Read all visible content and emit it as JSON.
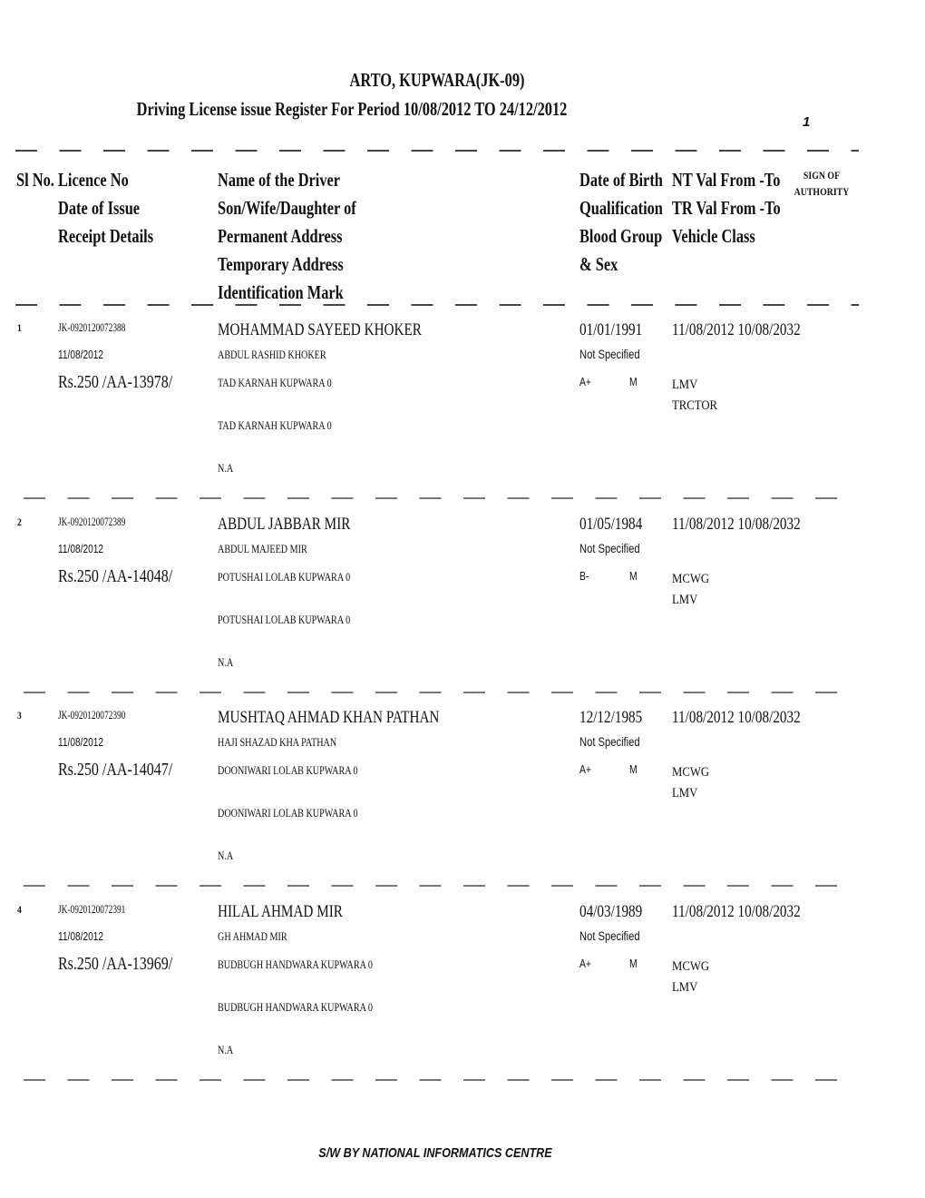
{
  "header": {
    "office": "ARTO, KUPWARA(JK-09)",
    "report_title": "Driving License issue Register For Period 10/08/2012 TO 24/12/2012",
    "page_number": "1"
  },
  "columns": {
    "col1": [
      "Sl No."
    ],
    "col2": [
      "Licence No",
      "Date of Issue",
      "Receipt  Details"
    ],
    "col3": [
      "Name of the Driver",
      "Son/Wife/Daughter of",
      "Permanent Address",
      "Temporary Address",
      "Identification Mark"
    ],
    "col4": [
      "Date of Birth",
      "Qualification",
      "Blood Group",
      "& Sex"
    ],
    "col5": [
      "NT Val From -To",
      "TR Val From -To",
      "Vehicle Class"
    ],
    "col6": [
      "SIGN OF",
      "AUTHORITY"
    ]
  },
  "records": [
    {
      "sl_no": "1",
      "licence_no": "JK-0920120072388",
      "date_of_issue": "11/08/2012",
      "receipt": "Rs.250 /AA-13978/",
      "driver_name": "MOHAMMAD SAYEED KHOKER",
      "relation_name": "ABDUL RASHID KHOKER",
      "permanent_address": "TAD  KARNAH  KUPWARA   0",
      "temporary_address": "TAD  KARNAH  KUPWARA   0",
      "identification_mark": "N.A",
      "dob": "01/01/1991",
      "qualification": "Not Specified",
      "blood_group": "A+",
      "sex": "M",
      "nt_validity": "11/08/2012  10/08/2032",
      "vehicle_classes": [
        "LMV",
        "TRCTOR"
      ]
    },
    {
      "sl_no": "2",
      "licence_no": "JK-0920120072389",
      "date_of_issue": "11/08/2012",
      "receipt": "Rs.250 /AA-14048/",
      "driver_name": "ABDUL JABBAR MIR",
      "relation_name": "ABDUL  MAJEED MIR",
      "permanent_address": "POTUSHAI  LOLAB KUPWARA  0",
      "temporary_address": "POTUSHAI  LOLAB KUPWARA  0",
      "identification_mark": "N.A",
      "dob": "01/05/1984",
      "qualification": "Not Specified",
      "blood_group": "B-",
      "sex": "M",
      "nt_validity": "11/08/2012  10/08/2032",
      "vehicle_classes": [
        "MCWG",
        "LMV"
      ]
    },
    {
      "sl_no": "3",
      "licence_no": "JK-0920120072390",
      "date_of_issue": "11/08/2012",
      "receipt": "Rs.250 /AA-14047/",
      "driver_name": "MUSHTAQ AHMAD KHAN PATHAN",
      "relation_name": "HAJI  SHAZAD  KHA  PATHAN",
      "permanent_address": "DOONIWARI LOLAB    KUPWARA  0",
      "temporary_address": "DOONIWARI LOLAB    KUPWARA  0",
      "identification_mark": "N.A",
      "dob": "12/12/1985",
      "qualification": "Not Specified",
      "blood_group": "A+",
      "sex": "M",
      "nt_validity": "11/08/2012  10/08/2032",
      "vehicle_classes": [
        "MCWG",
        "LMV"
      ]
    },
    {
      "sl_no": "4",
      "licence_no": "JK-0920120072391",
      "date_of_issue": "11/08/2012",
      "receipt": "Rs.250 /AA-13969/",
      "driver_name": "HILAL AHMAD MIR",
      "relation_name": "GH  AHMAD MIR",
      "permanent_address": "BUDBUGH    HANDWARA KUPWARA  0",
      "temporary_address": "BUDBUGH    HANDWARA KUPWARA  0",
      "identification_mark": "N.A",
      "dob": "04/03/1989",
      "qualification": "Not Specified",
      "blood_group": "A+",
      "sex": "M",
      "nt_validity": "11/08/2012  10/08/2032",
      "vehicle_classes": [
        "MCWG",
        "LMV"
      ]
    }
  ],
  "footer": {
    "credit": "S/W BY NATIONAL INFORMATICS CENTRE"
  }
}
